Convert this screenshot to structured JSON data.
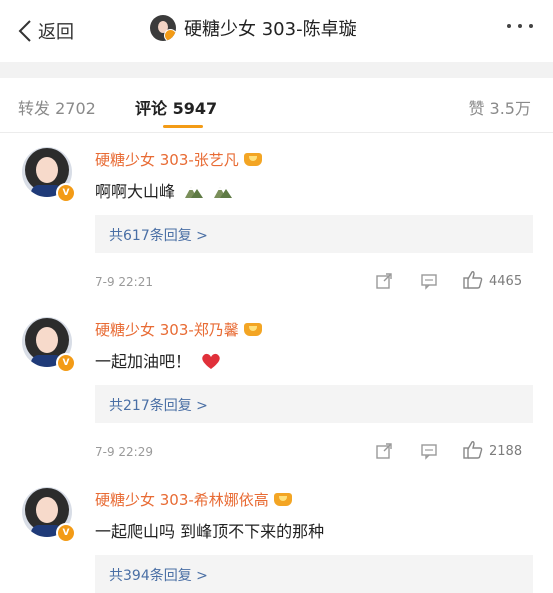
{
  "header": {
    "back_label": "返回",
    "title": "硬糖少女 303-陈卓璇"
  },
  "tabs": {
    "reposts": "转发 2702",
    "comments": "评论 5947",
    "likes": "赞 3.5万"
  },
  "comments": [
    {
      "name": "硬糖少女 303-张艺凡",
      "text": "啊啊大山峰",
      "replies": "共617条回复 >",
      "time": "7-9 22:21",
      "likes": "4465"
    },
    {
      "name": "硬糖少女 303-郑乃馨",
      "text": "一起加油吧！",
      "replies": "共217条回复 >",
      "time": "7-9 22:29",
      "likes": "2188"
    },
    {
      "name": "硬糖少女 303-希林娜依高",
      "text": "一起爬山吗 到峰顶不下来的那种",
      "replies": "共394条回复 >"
    }
  ],
  "colors": {
    "accent": "#f39b16",
    "name": "#e86b34",
    "reply_link": "#4a6fa5"
  }
}
